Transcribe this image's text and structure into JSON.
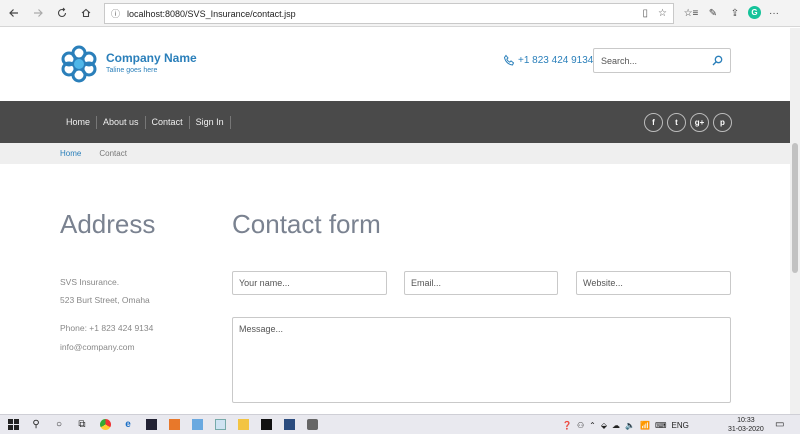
{
  "browser": {
    "url": "localhost:8080/SVS_Insurance/contact.jsp"
  },
  "header": {
    "company_name": "Company Name",
    "tagline": "Taline goes here",
    "phone": "+1 823 424 9134",
    "search_placeholder": "Search..."
  },
  "nav": {
    "items": [
      "Home",
      "About us",
      "Contact",
      "Sign In"
    ],
    "socials": [
      "f",
      "t",
      "g+",
      "p"
    ]
  },
  "breadcrumb": {
    "home": "Home",
    "current": "Contact"
  },
  "address": {
    "heading": "Address",
    "line1": "SVS Insurance.",
    "line2": "523 Burt Street, Omaha",
    "phone": "Phone: +1 823 424 9134",
    "email": "info@company.com"
  },
  "contact_form": {
    "heading": "Contact form",
    "name_placeholder": "Your name...",
    "email_placeholder": "Email...",
    "website_placeholder": "Website...",
    "message_placeholder": "Message..."
  },
  "taskbar": {
    "language": "ENG",
    "time": "10:33",
    "date": "31-03-2020"
  },
  "colors": {
    "brand_blue": "#2a7fba",
    "navbar": "#4a4a4a",
    "heading_gray": "#7a8290"
  }
}
